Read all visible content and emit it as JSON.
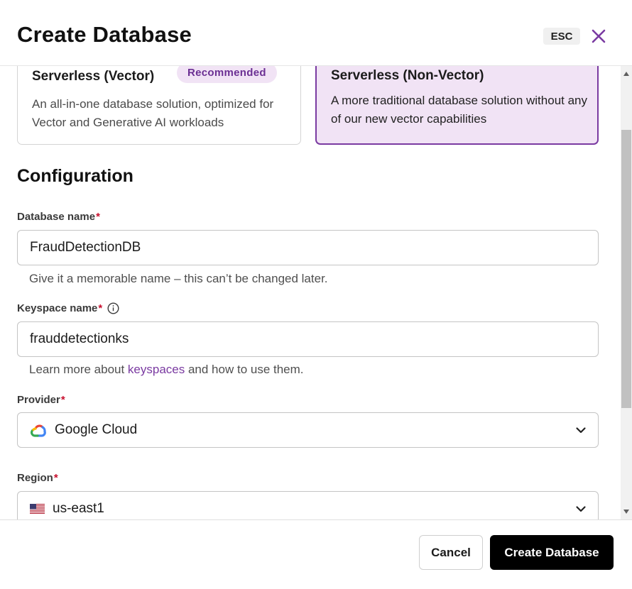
{
  "header": {
    "title": "Create Database",
    "esc_label": "ESC"
  },
  "db_types": [
    {
      "title": "Serverless (Vector)",
      "badge": "Recommended",
      "description": "An all-in-one database solution, optimized for Vector and Generative AI workloads",
      "selected": false
    },
    {
      "title": "Serverless (Non-Vector)",
      "description": "A more traditional database solution without any of our new vector capabilities",
      "selected": true
    }
  ],
  "configuration": {
    "section_title": "Configuration",
    "database_name": {
      "label": "Database name",
      "required_mark": "*",
      "value": "FraudDetectionDB",
      "helper": "Give it a memorable name – this can’t be changed later."
    },
    "keyspace_name": {
      "label": "Keyspace name",
      "required_mark": "*",
      "value": "frauddetectionks",
      "helper_before": "Learn more about ",
      "helper_link": "keyspaces",
      "helper_after": " and how to use them."
    },
    "provider": {
      "label": "Provider",
      "required_mark": "*",
      "value": "Google Cloud",
      "icon": "google-cloud-logo"
    },
    "region": {
      "label": "Region",
      "required_mark": "*",
      "value": "us-east1",
      "icon": "us-flag"
    }
  },
  "footer": {
    "cancel_label": "Cancel",
    "create_label": "Create Database"
  },
  "colors": {
    "accent": "#7a3aa1",
    "selected_bg": "#f1e3f5",
    "required": "#c8102e",
    "primary_button": "#000000"
  }
}
